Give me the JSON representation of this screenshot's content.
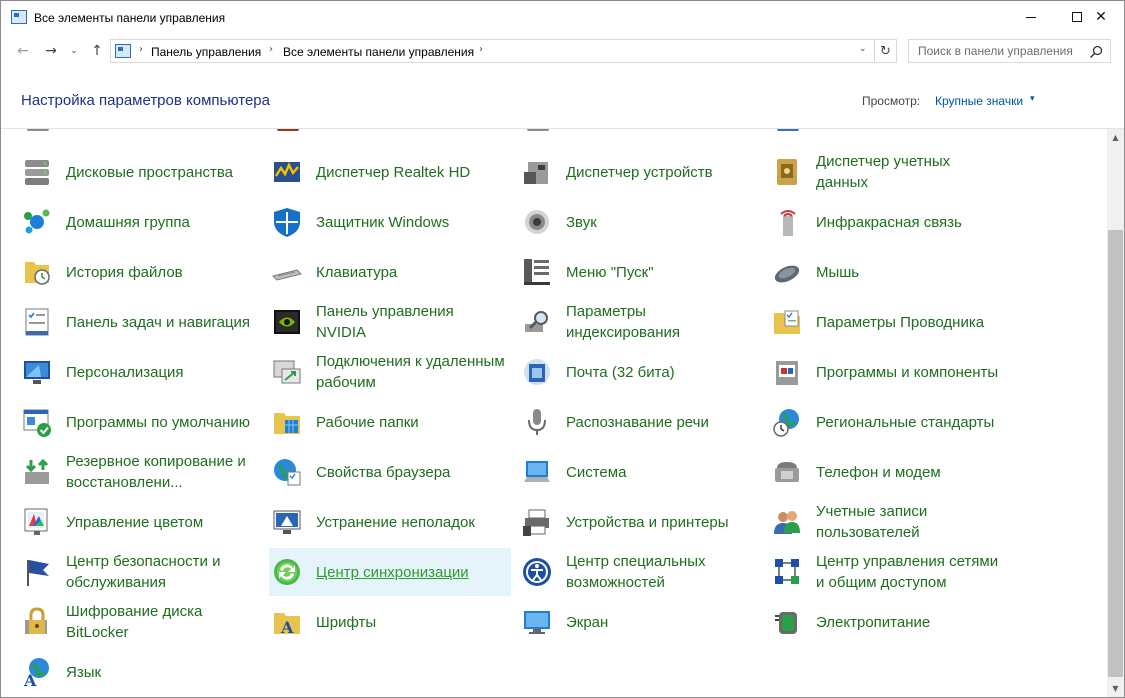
{
  "window": {
    "title": "Все элементы панели управления",
    "minimize_glyph": "—",
    "maximize_glyph": "☐",
    "close_glyph": "✕"
  },
  "nav": {
    "back_glyph": "←",
    "forward_glyph": "→",
    "recent_glyph": "⌄",
    "up_glyph": "↑",
    "refresh_glyph": "↻",
    "dropdown_glyph": "⌄"
  },
  "address": {
    "separator": "›",
    "crumbs": [
      "Панель управления",
      "Все элементы панели управления"
    ]
  },
  "search": {
    "placeholder": "Поиск в панели управления",
    "value": ""
  },
  "header": {
    "title": "Настройка параметров компьютера",
    "view_label": "Просмотр:",
    "view_value": "Крупные значки",
    "view_caret": "▾"
  },
  "items": [
    {
      "label": "Дисковые пространства",
      "icon": "storage-spaces-icon"
    },
    {
      "label": "Диспетчер Realtek HD",
      "icon": "realtek-audio-icon"
    },
    {
      "label": "Диспетчер устройств",
      "icon": "device-manager-icon"
    },
    {
      "label": "Диспетчер учетных данных",
      "icon": "credential-manager-icon"
    },
    {
      "label": "Домашняя группа",
      "icon": "homegroup-icon"
    },
    {
      "label": "Защитник Windows",
      "icon": "windows-defender-icon"
    },
    {
      "label": "Звук",
      "icon": "sound-icon"
    },
    {
      "label": "Инфракрасная связь",
      "icon": "infrared-icon"
    },
    {
      "label": "История файлов",
      "icon": "file-history-icon"
    },
    {
      "label": "Клавиатура",
      "icon": "keyboard-icon"
    },
    {
      "label": "Меню \"Пуск\"",
      "icon": "start-menu-icon"
    },
    {
      "label": "Мышь",
      "icon": "mouse-icon"
    },
    {
      "label": "Панель задач и навигация",
      "icon": "taskbar-icon"
    },
    {
      "label": "Панель управления NVIDIA",
      "icon": "nvidia-icon"
    },
    {
      "label": "Параметры индексирования",
      "icon": "indexing-icon"
    },
    {
      "label": "Параметры Проводника",
      "icon": "explorer-options-icon"
    },
    {
      "label": "Персонализация",
      "icon": "personalization-icon"
    },
    {
      "label": "Подключения к удаленным рабочим",
      "icon": "remote-desktop-icon"
    },
    {
      "label": "Почта (32 бита)",
      "icon": "mail-icon"
    },
    {
      "label": "Программы и компоненты",
      "icon": "programs-features-icon"
    },
    {
      "label": "Программы по умолчанию",
      "icon": "default-programs-icon"
    },
    {
      "label": "Рабочие папки",
      "icon": "work-folders-icon"
    },
    {
      "label": "Распознавание речи",
      "icon": "speech-recognition-icon"
    },
    {
      "label": "Региональные стандарты",
      "icon": "region-icon"
    },
    {
      "label": "Резервное копирование и восстановлени...",
      "icon": "backup-restore-icon"
    },
    {
      "label": "Свойства браузера",
      "icon": "internet-options-icon"
    },
    {
      "label": "Система",
      "icon": "system-icon"
    },
    {
      "label": "Телефон и модем",
      "icon": "phone-modem-icon"
    },
    {
      "label": "Управление цветом",
      "icon": "color-management-icon"
    },
    {
      "label": "Устранение неполадок",
      "icon": "troubleshooting-icon"
    },
    {
      "label": "Устройства и принтеры",
      "icon": "devices-printers-icon"
    },
    {
      "label": "Учетные записи пользователей",
      "icon": "user-accounts-icon"
    },
    {
      "label": "Центр безопасности и обслуживания",
      "icon": "security-maintenance-icon"
    },
    {
      "label": "Центр синхронизации",
      "icon": "sync-center-icon"
    },
    {
      "label": "Центр специальных возможностей",
      "icon": "ease-of-access-icon"
    },
    {
      "label": "Центр управления сетями и общим доступом",
      "icon": "network-sharing-icon"
    },
    {
      "label": "Шифрование диска BitLocker",
      "icon": "bitlocker-icon"
    },
    {
      "label": "Шрифты",
      "icon": "fonts-icon"
    },
    {
      "label": "Экран",
      "icon": "display-icon"
    },
    {
      "label": "Электропитание",
      "icon": "power-options-icon"
    },
    {
      "label": "Язык",
      "icon": "language-icon"
    }
  ],
  "hovered_item": "Центр синхронизации",
  "colors": {
    "link_green": "#1f6e1f",
    "hover_green": "#2c9c2c",
    "hover_bg": "#e5f3fb",
    "header_title_blue": "#1e3287",
    "view_value_blue": "#0053a6"
  },
  "scrollbar": {
    "up_glyph": "▲",
    "down_glyph": "▼",
    "position_fraction": 0.2
  }
}
